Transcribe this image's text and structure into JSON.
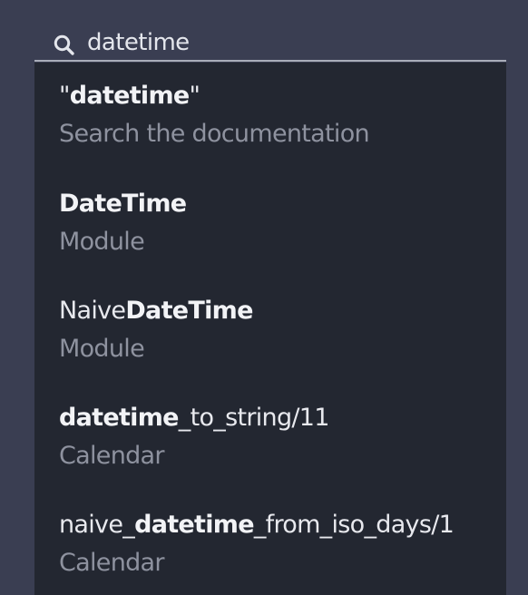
{
  "search": {
    "value": "datetime",
    "icon": "search-icon"
  },
  "results": [
    {
      "prefix": "\"",
      "match": "datetime",
      "suffix": "\"",
      "description": "Search the documentation"
    },
    {
      "prefix": "",
      "match": "DateTime",
      "suffix": "",
      "description": "Module"
    },
    {
      "prefix": "Naive",
      "match": "DateTime",
      "suffix": "",
      "description": "Module"
    },
    {
      "prefix": "",
      "match": "datetime",
      "suffix": "_to_string/11",
      "description": "Calendar"
    },
    {
      "prefix": "naive_",
      "match": "datetime",
      "suffix": "_from_iso_days/1",
      "description": "Calendar"
    }
  ],
  "colors": {
    "page_background": "#3a3e52",
    "dropdown_background": "#232731",
    "title_text": "#e8e9ee",
    "description_text": "#8e929f"
  }
}
